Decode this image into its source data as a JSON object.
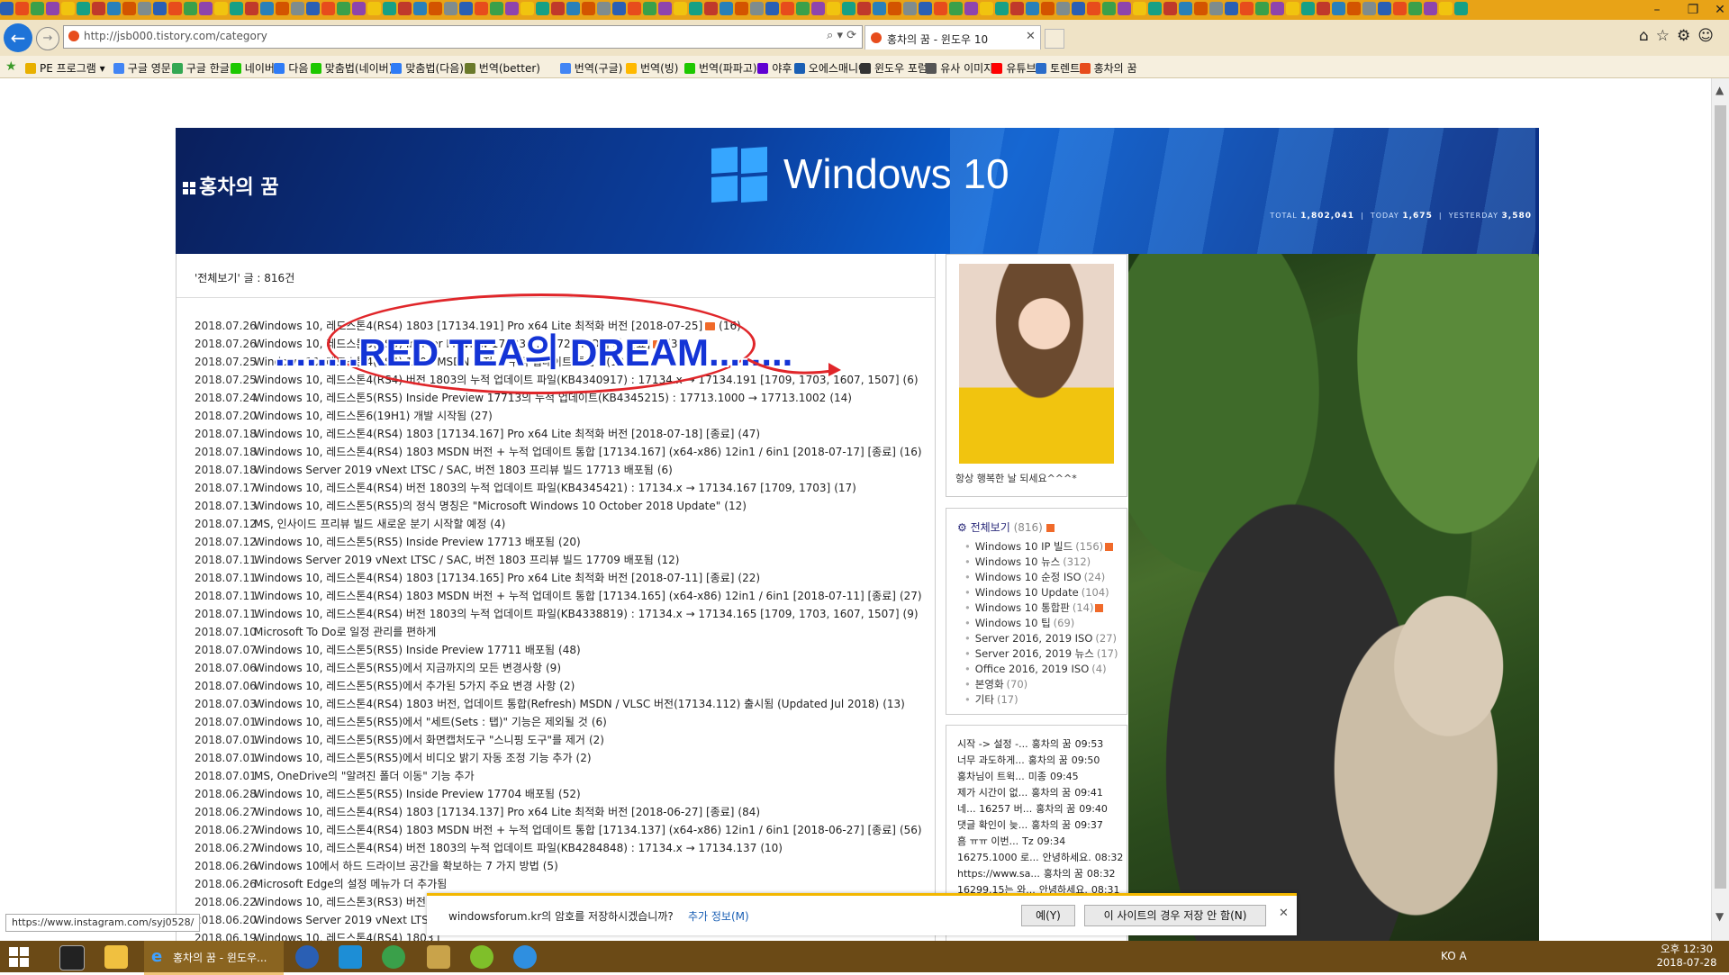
{
  "browser": {
    "address": "http://jsb000.tistory.com/category",
    "tab_title": "홍차의 꿈 - 윈도우 10",
    "status_url": "https://www.instagram.com/syj0528/",
    "favorites": [
      {
        "label": "PE 프로그램 ▾",
        "color": "#e8b000"
      },
      {
        "label": "구글 영문",
        "color": "#4285f4"
      },
      {
        "label": "구글 한글",
        "color": "#34a853"
      },
      {
        "label": "네이버",
        "color": "#1ec800"
      },
      {
        "label": "다음",
        "color": "#2f7cf6"
      },
      {
        "label": "맞춤법(네이버)",
        "color": "#1ec800"
      },
      {
        "label": "맞춤법(다음)",
        "color": "#2f7cf6"
      },
      {
        "label": "번역(better)",
        "color": "#6b7a2b"
      },
      {
        "label": "번역(구글)",
        "color": "#4285f4"
      },
      {
        "label": "번역(빙)",
        "color": "#ffb900"
      },
      {
        "label": "번역(파파고)",
        "color": "#1ec800"
      },
      {
        "label": "야후",
        "color": "#6001d2"
      },
      {
        "label": "오에스매니아",
        "color": "#1a5fb4"
      },
      {
        "label": "윈도우 포럼",
        "color": "#333333"
      },
      {
        "label": "유사 이미지",
        "color": "#555555"
      },
      {
        "label": "유튜브",
        "color": "#ff0000"
      },
      {
        "label": "토렌트",
        "color": "#2a6cc9"
      },
      {
        "label": "홍차의 꿈",
        "color": "#e74c1c"
      }
    ]
  },
  "banner": {
    "blog_title": "홍차의 꿈",
    "windows_text": "Windows 10",
    "stats_total_label": "TOTAL",
    "stats_total": "1,802,041",
    "stats_today_label": "TODAY",
    "stats_today": "1,675",
    "stats_yesterday_label": "YESTERDAY",
    "stats_yesterday": "3,580"
  },
  "content": {
    "header": "'전체보기' 글 : 816건",
    "posts": [
      {
        "date": "2018.07.26",
        "title": "Windows 10, 레드스톤4(RS4) 1803 [17134.191] Pro x64 Lite 최적화 버전 [2018-07-25]",
        "new": true,
        "count": "(16)"
      },
      {
        "date": "2018.07.26",
        "title": "Windows 10, 레드스톤5(RS5) Insider Preview 17723 ... 17728 ISO 추가 완료]",
        "new": true,
        "count": "(36)"
      },
      {
        "date": "2018.07.25",
        "title": "Windows 10, 레드스톤4(RS4) 1803 MSDN 버전 + 누적 업데이트 통합 [",
        "new": false,
        "count": "(12)"
      },
      {
        "date": "2018.07.25",
        "title": "Windows 10, 레드스톤4(RS4) 버전 1803의 누적 업데이트 파일(KB4340917) : 17134.x → 17134.191 [1709, 1703, 1607, 1507]",
        "new": false,
        "count": "(6)"
      },
      {
        "date": "2018.07.24",
        "title": "Windows 10, 레드스톤5(RS5) Inside Preview 17713의 누적 업데이트(KB4345215) : 17713.1000 → 17713.1002",
        "new": false,
        "count": "(14)"
      },
      {
        "date": "2018.07.20",
        "title": "Windows 10, 레드스톤6(19H1) 개발 시작됨",
        "new": false,
        "count": "(27)"
      },
      {
        "date": "2018.07.18",
        "title": "Windows 10, 레드스톤4(RS4) 1803 [17134.167] Pro x64 Lite 최적화 버전 [2018-07-18] [종료]",
        "new": false,
        "count": "(47)"
      },
      {
        "date": "2018.07.18",
        "title": "Windows 10, 레드스톤4(RS4) 1803 MSDN 버전 + 누적 업데이트 통합 [17134.167] (x64-x86) 12in1 / 6in1 [2018-07-17] [종료]",
        "new": false,
        "count": "(16)"
      },
      {
        "date": "2018.07.18",
        "title": "Windows Server 2019 vNext LTSC / SAC, 버전 1803 프리뷰 빌드 17713 배포됨",
        "new": false,
        "count": "(6)"
      },
      {
        "date": "2018.07.17",
        "title": "Windows 10, 레드스톤4(RS4) 버전 1803의 누적 업데이트 파일(KB4345421) : 17134.x → 17134.167 [1709, 1703]",
        "new": false,
        "count": "(17)"
      },
      {
        "date": "2018.07.13",
        "title": "Windows 10, 레드스톤5(RS5)의 정식 명칭은 \"Microsoft Windows 10 October 2018 Update\"",
        "new": false,
        "count": "(12)"
      },
      {
        "date": "2018.07.12",
        "title": "MS, 인사이드 프리뷰 빌드 새로운 분기 시작할 예정",
        "new": false,
        "count": "(4)"
      },
      {
        "date": "2018.07.12",
        "title": "Windows 10, 레드스톤5(RS5) Inside Preview 17713 배포됨",
        "new": false,
        "count": "(20)"
      },
      {
        "date": "2018.07.11",
        "title": "Windows Server 2019 vNext LTSC / SAC, 버전 1803 프리뷰 빌드 17709 배포됨",
        "new": false,
        "count": "(12)"
      },
      {
        "date": "2018.07.11",
        "title": "Windows 10, 레드스톤4(RS4) 1803 [17134.165] Pro x64 Lite 최적화 버전 [2018-07-11] [종료]",
        "new": false,
        "count": "(22)"
      },
      {
        "date": "2018.07.11",
        "title": "Windows 10, 레드스톤4(RS4) 1803 MSDN 버전 + 누적 업데이트 통합 [17134.165] (x64-x86) 12in1 / 6in1 [2018-07-11] [종료]",
        "new": false,
        "count": "(27)"
      },
      {
        "date": "2018.07.11",
        "title": "Windows 10, 레드스톤4(RS4) 버전 1803의 누적 업데이트 파일(KB4338819) : 17134.x → 17134.165 [1709, 1703, 1607, 1507]",
        "new": false,
        "count": "(9)"
      },
      {
        "date": "2018.07.10",
        "title": "Microsoft To Do로 일정 관리를 편하게",
        "new": false,
        "count": ""
      },
      {
        "date": "2018.07.07",
        "title": "Windows 10, 레드스톤5(RS5) Inside Preview 17711 배포됨",
        "new": false,
        "count": "(48)"
      },
      {
        "date": "2018.07.06",
        "title": "Windows 10, 레드스톤5(RS5)에서 지금까지의 모든 변경사항",
        "new": false,
        "count": "(9)"
      },
      {
        "date": "2018.07.06",
        "title": "Windows 10, 레드스톤5(RS5)에서 추가된 5가지 주요 변경 사항",
        "new": false,
        "count": "(2)"
      },
      {
        "date": "2018.07.03",
        "title": "Windows 10, 레드스톤4(RS4) 1803 버전, 업데이트 통합(Refresh) MSDN / VLSC 버전(17134.112) 출시됨 (Updated Jul 2018)",
        "new": false,
        "count": "(13)"
      },
      {
        "date": "2018.07.01",
        "title": "Windows 10, 레드스톤5(RS5)에서 \"세트(Sets : 탭)\" 기능은 제외될 것",
        "new": false,
        "count": "(6)"
      },
      {
        "date": "2018.07.01",
        "title": "Windows 10, 레드스톤5(RS5)에서 화면캡처도구 \"스니핑 도구\"를 제거",
        "new": false,
        "count": "(2)"
      },
      {
        "date": "2018.07.01",
        "title": "Windows 10, 레드스톤5(RS5)에서 비디오 밝기 자동 조정 기능 추가",
        "new": false,
        "count": "(2)"
      },
      {
        "date": "2018.07.01",
        "title": "MS, OneDrive의 \"알려진 폴더 이동\" 기능 추가",
        "new": false,
        "count": ""
      },
      {
        "date": "2018.06.28",
        "title": "Windows 10, 레드스톤5(RS5) Inside Preview 17704 배포됨",
        "new": false,
        "count": "(52)"
      },
      {
        "date": "2018.06.27",
        "title": "Windows 10, 레드스톤4(RS4) 1803 [17134.137] Pro x64 Lite 최적화 버전 [2018-06-27] [종료]",
        "new": false,
        "count": "(84)"
      },
      {
        "date": "2018.06.27",
        "title": "Windows 10, 레드스톤4(RS4) 1803 MSDN 버전 + 누적 업데이트 통합 [17134.137] (x64-x86) 12in1 / 6in1 [2018-06-27] [종료]",
        "new": false,
        "count": "(56)"
      },
      {
        "date": "2018.06.27",
        "title": "Windows 10, 레드스톤4(RS4) 버전 1803의 누적 업데이트 파일(KB4284848) : 17134.x → 17134.137",
        "new": false,
        "count": "(10)"
      },
      {
        "date": "2018.06.26",
        "title": "Windows 10에서 하드 드라이브 공간을 확보하는 7 가지 방법",
        "new": false,
        "count": "(5)"
      },
      {
        "date": "2018.06.26",
        "title": "Microsoft Edge의 설정 메뉴가 더 추가됨",
        "new": false,
        "count": ""
      },
      {
        "date": "2018.06.22",
        "title": "Windows 10, 레드스톤3(RS3) 버전 17",
        "new": false,
        "count": ""
      },
      {
        "date": "2018.06.20",
        "title": "Windows Server 2019 vNext LTSC / S",
        "new": false,
        "count": ""
      },
      {
        "date": "2018.06.19",
        "title": "Windows 10, 레드스톤4(RS4) 1803 [",
        "new": false,
        "count": ""
      }
    ]
  },
  "annotation": {
    "text": "........RED TEA의 DREAM........"
  },
  "sidebar": {
    "profile_caption": "항상 행복한 날 되세요^^^*",
    "category_title": "전체보기",
    "category_count": "(816)",
    "categories": [
      {
        "label": "Windows 10 IP 빌드",
        "count": "(156)",
        "new": true
      },
      {
        "label": "Windows 10 뉴스",
        "count": "(312)",
        "new": false
      },
      {
        "label": "Windows 10 순정 ISO",
        "count": "(24)",
        "new": false
      },
      {
        "label": "Windows 10 Update",
        "count": "(104)",
        "new": false
      },
      {
        "label": "Windows 10 통합판",
        "count": "(14)",
        "new": true
      },
      {
        "label": "Windows 10 팁",
        "count": "(69)",
        "new": false
      },
      {
        "label": "Server 2016, 2019 ISO",
        "count": "(27)",
        "new": false
      },
      {
        "label": "Server 2016, 2019 뉴스",
        "count": "(17)",
        "new": false
      },
      {
        "label": "Office 2016, 2019 ISO",
        "count": "(4)",
        "new": false
      },
      {
        "label": "본영화",
        "count": "(70)",
        "new": false
      },
      {
        "label": "기타",
        "count": "(17)",
        "new": false
      }
    ],
    "comments": [
      {
        "text": "시작 -> 설정 -...",
        "who": "홍차의 꿈",
        "time": "09:53"
      },
      {
        "text": "너무 과도하게...",
        "who": "홍차의 꿈",
        "time": "09:50"
      },
      {
        "text": "홍차님이 트윅...",
        "who": "미종",
        "time": "09:45"
      },
      {
        "text": "제가 시간이 없...",
        "who": "홍차의 꿈",
        "time": "09:41"
      },
      {
        "text": "네... 16257 버...",
        "who": "홍차의 꿈",
        "time": "09:40"
      },
      {
        "text": "댓글 확인이 늦...",
        "who": "홍차의 꿈",
        "time": "09:37"
      },
      {
        "text": "흠 ㅠㅠ 이번...",
        "who": "Tz",
        "time": "09:34"
      },
      {
        "text": "16275.1000 로...",
        "who": "안녕하세요.",
        "time": "08:32"
      },
      {
        "text": "https://www.sa...",
        "who": "홍차의 꿈",
        "time": "08:32"
      },
      {
        "text": "16299.15는 와...",
        "who": "안녕하세요.",
        "time": "08:31"
      }
    ]
  },
  "password_prompt": {
    "message": "windowsforum.kr의 암호를 저장하시겠습니까?",
    "more_info": "추가 정보(M)",
    "yes": "예(Y)",
    "never": "이 사이트의 경우 저장 안 함(N)"
  },
  "taskbar": {
    "active_label": "홍차의 꿈 - 윈도우...",
    "tray_text": "KO  A",
    "time": "오후 12:30",
    "date": "2018-07-28"
  }
}
